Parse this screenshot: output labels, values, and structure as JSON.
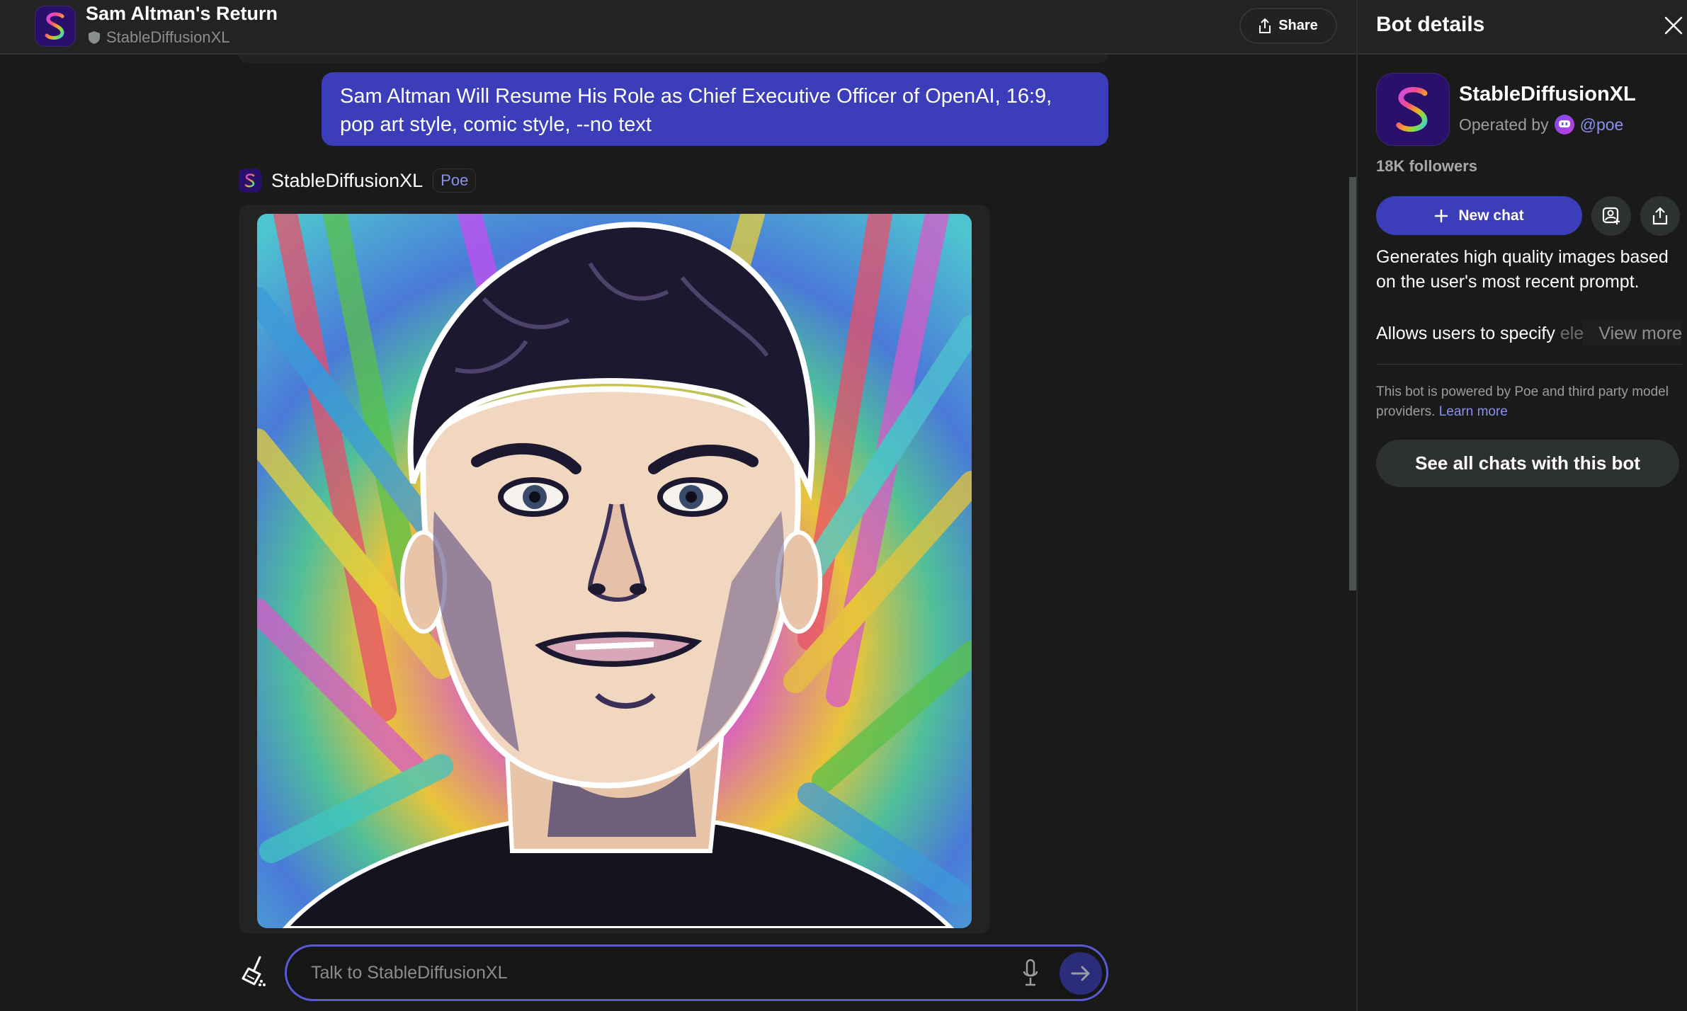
{
  "header": {
    "title": "Sam Altman's Return",
    "bot_name": "StableDiffusionXL",
    "share_label": "Share"
  },
  "conversation": {
    "user_message": "Sam Altman Will Resume His Role as Chief Executive Officer of OpenAI, 16:9, pop art style, comic style, --no text",
    "bot_name": "StableDiffusionXL",
    "bot_badge": "Poe",
    "image_alt": "Pop art comic-style portrait of Sam Altman with rainbow radial brush-stroke background"
  },
  "composer": {
    "placeholder": "Talk to StableDiffusionXL",
    "value": ""
  },
  "side_panel": {
    "title": "Bot details",
    "bot_name": "StableDiffusionXL",
    "operated_by_label": "Operated by",
    "operator_handle": "@poe",
    "followers": "18K followers",
    "new_chat_label": "New chat",
    "description": "Generates high quality images based on the user's most recent prompt.",
    "description2_visible": "Allows users to specify ",
    "description2_faded": "ele",
    "view_more_label": "View more",
    "powered_by": "This bot is powered by Poe and third party model providers. ",
    "learn_more_label": "Learn more",
    "see_all_label": "See all chats with this bot"
  },
  "colors": {
    "accent": "#3c3db8",
    "link": "#8b8ff0",
    "background": "#1a1a1a",
    "header": "#232323"
  }
}
